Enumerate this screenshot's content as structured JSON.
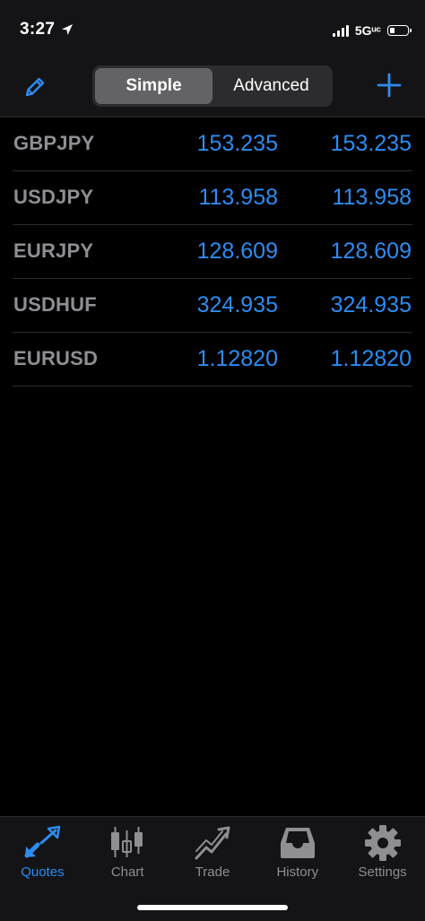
{
  "status_bar": {
    "time": "3:27",
    "network": "5Gᵘᶜ",
    "battery_level": 0.28,
    "location_icon": "location-arrow-icon",
    "signal_icon": "cellular-signal-icon",
    "battery_icon": "battery-icon"
  },
  "nav": {
    "edit_icon": "pencil-icon",
    "add_icon": "plus-icon",
    "segments": [
      {
        "label": "Simple",
        "active": true
      },
      {
        "label": "Advanced",
        "active": false
      }
    ]
  },
  "quotes": [
    {
      "symbol": "GBPJPY",
      "bid": "153.235",
      "ask": "153.235"
    },
    {
      "symbol": "USDJPY",
      "bid": "113.958",
      "ask": "113.958"
    },
    {
      "symbol": "EURJPY",
      "bid": "128.609",
      "ask": "128.609"
    },
    {
      "symbol": "USDHUF",
      "bid": "324.935",
      "ask": "324.935"
    },
    {
      "symbol": "EURUSD",
      "bid": "1.12820",
      "ask": "1.12820"
    }
  ],
  "tabs": [
    {
      "label": "Quotes",
      "icon": "quotes-arrows-icon",
      "active": true
    },
    {
      "label": "Chart",
      "icon": "candlestick-icon",
      "active": false
    },
    {
      "label": "Trade",
      "icon": "trend-icon",
      "active": false
    },
    {
      "label": "History",
      "icon": "inbox-tray-icon",
      "active": false
    },
    {
      "label": "Settings",
      "icon": "gear-icon",
      "active": false
    }
  ],
  "colors": {
    "accent": "#2d8cf0",
    "symbol_gray": "#8e8e93",
    "background": "#000000",
    "bar_background": "#141416"
  }
}
